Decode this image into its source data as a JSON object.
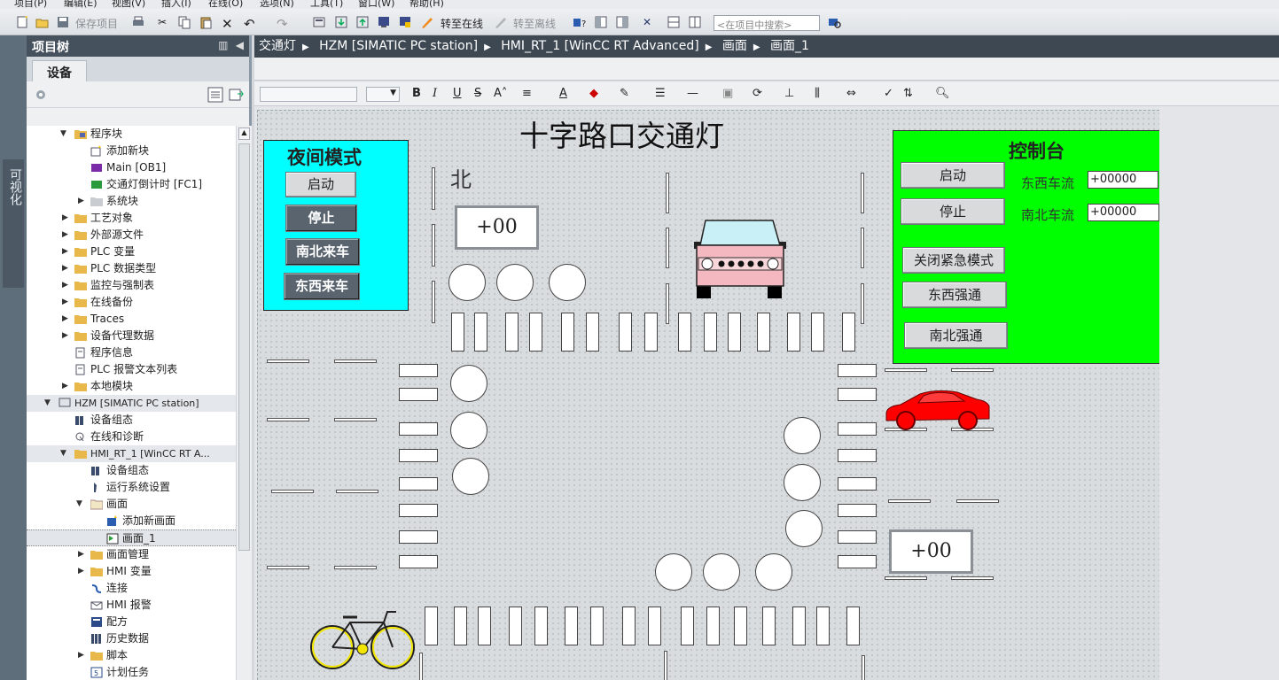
{
  "menubar": {
    "items": [
      "项目(P)",
      "编辑(E)",
      "视图(V)",
      "插入(I)",
      "在线(O)",
      "选项(N)",
      "工具(T)",
      "窗口(W)",
      "帮助(H)"
    ]
  },
  "toolbar": {
    "save_project": "保存项目",
    "go_online": "转至在线",
    "go_offline": "转至离线",
    "search_placeholder": "<在项目中搜索>"
  },
  "vstrip": {
    "tab_label": "可视化"
  },
  "project_tree": {
    "title": "项目树",
    "tab_devices": "设备",
    "rows": [
      {
        "label": "程序块",
        "level": 2,
        "expanded": true
      },
      {
        "label": "添加新块",
        "level": 3
      },
      {
        "label": "Main [OB1]",
        "level": 3
      },
      {
        "label": "交通灯倒计时 [FC1]",
        "level": 3
      },
      {
        "label": "系统块",
        "level": 3,
        "expanded": false
      },
      {
        "label": "工艺对象",
        "level": 2,
        "expanded": false
      },
      {
        "label": "外部源文件",
        "level": 2,
        "expanded": false
      },
      {
        "label": "PLC 变量",
        "level": 2,
        "expanded": false
      },
      {
        "label": "PLC 数据类型",
        "level": 2,
        "expanded": false
      },
      {
        "label": "监控与强制表",
        "level": 2,
        "expanded": false
      },
      {
        "label": "在线备份",
        "level": 2,
        "expanded": false
      },
      {
        "label": "Traces",
        "level": 2,
        "expanded": false
      },
      {
        "label": "设备代理数据",
        "level": 2,
        "expanded": false
      },
      {
        "label": "程序信息",
        "level": 2
      },
      {
        "label": "PLC 报警文本列表",
        "level": 2
      },
      {
        "label": "本地模块",
        "level": 2,
        "expanded": false
      },
      {
        "label": "HZM [SIMATIC PC station]",
        "level": 1,
        "expanded": true
      },
      {
        "label": "设备组态",
        "level": 2
      },
      {
        "label": "在线和诊断",
        "level": 2
      },
      {
        "label": "HMI_RT_1 [WinCC RT A...",
        "level": 2,
        "expanded": true
      },
      {
        "label": "设备组态",
        "level": 3
      },
      {
        "label": "运行系统设置",
        "level": 3
      },
      {
        "label": "画面",
        "level": 3,
        "expanded": true
      },
      {
        "label": "添加新画面",
        "level": 4
      },
      {
        "label": "画面_1",
        "level": 4,
        "selected": true
      },
      {
        "label": "画面管理",
        "level": 3,
        "expanded": false
      },
      {
        "label": "HMI 变量",
        "level": 3,
        "expanded": false
      },
      {
        "label": "连接",
        "level": 3
      },
      {
        "label": "HMI 报警",
        "level": 3
      },
      {
        "label": "配方",
        "level": 3
      },
      {
        "label": "历史数据",
        "level": 3
      },
      {
        "label": "脚本",
        "level": 3,
        "expanded": false
      },
      {
        "label": "计划任务",
        "level": 3
      }
    ]
  },
  "breadcrumb": [
    "交通灯",
    "HZM [SIMATIC PC station]",
    "HMI_RT_1 [WinCC RT Advanced]",
    "画面",
    "画面_1"
  ],
  "hmi": {
    "title": "十字路口交通灯",
    "north_label": "北",
    "night_panel": {
      "title": "夜间模式",
      "start": "启动",
      "stop": "停止",
      "ns_car": "南北来车",
      "ew_car": "东西来车"
    },
    "control_panel": {
      "title": "控制台",
      "start": "启动",
      "stop": "停止",
      "ew_flow_label": "东西车流",
      "ns_flow_label": "南北车流",
      "ew_flow_value": "+00000",
      "ns_flow_value": "+00000",
      "close_emergency": "关闭紧急模式",
      "ew_force": "东西强通",
      "ns_force": "南北强通"
    },
    "timer_north": "+00",
    "timer_east": "+00"
  },
  "colors": {
    "night_panel_bg": "#00ffff",
    "control_panel_bg": "#00ff00",
    "red_car": "#ff0000",
    "pink_car": "#f4b8c0",
    "bike": "#f2e600"
  }
}
